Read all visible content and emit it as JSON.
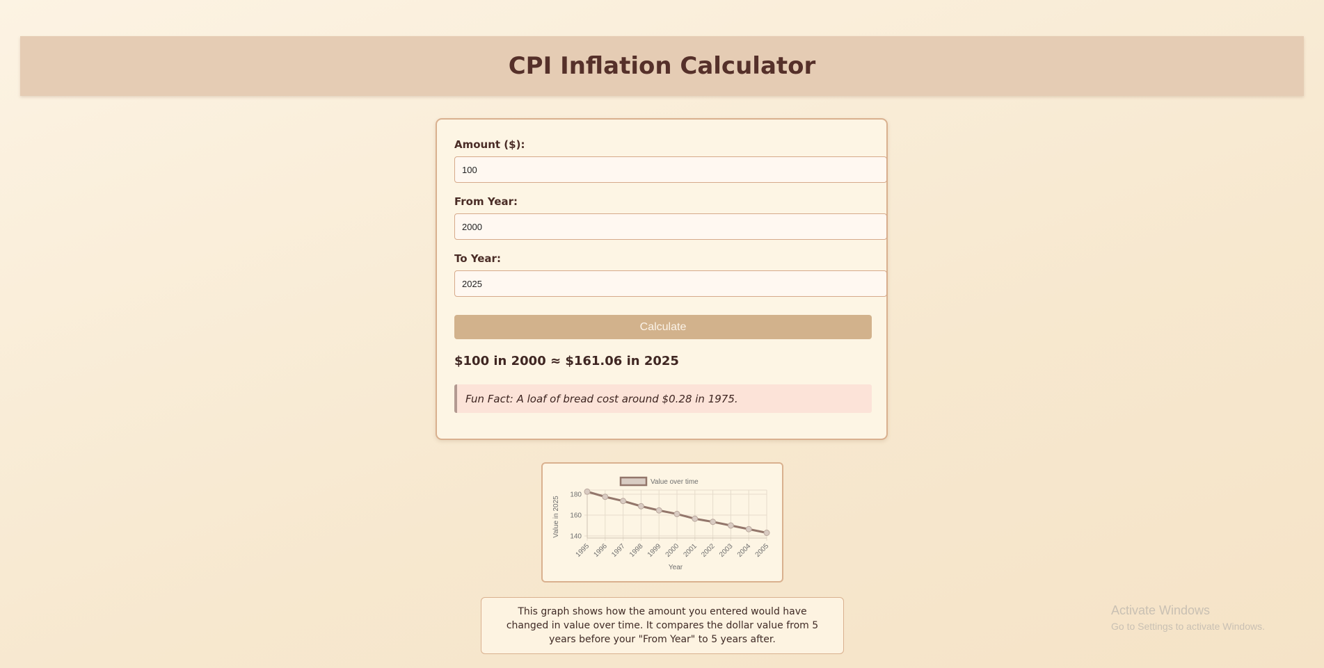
{
  "header": {
    "title": "CPI Inflation Calculator"
  },
  "form": {
    "amount_label": "Amount ($):",
    "amount_value": "100",
    "from_label": "From Year:",
    "from_value": "2000",
    "to_label": "To Year:",
    "to_value": "2025",
    "calculate_label": "Calculate"
  },
  "result": {
    "text": "$100 in 2000 ≈ $161.06 in 2025"
  },
  "fun_fact": {
    "text": "Fun Fact: A loaf of bread cost around $0.28 in 1975."
  },
  "chart_data": {
    "type": "line",
    "legend": "Value over time",
    "xlabel": "Year",
    "ylabel": "Value in 2025",
    "categories": [
      "1995",
      "1996",
      "1997",
      "1998",
      "1999",
      "2000",
      "2001",
      "2002",
      "2003",
      "2004",
      "2005"
    ],
    "series": [
      {
        "name": "Value over time",
        "values": [
          182.5,
          177.5,
          173.5,
          168.5,
          164.5,
          161.06,
          156.5,
          153.5,
          150.0,
          146.5,
          143.0
        ]
      }
    ],
    "yticks": [
      140,
      160,
      180
    ],
    "ylim": [
      138,
      184
    ],
    "grid": true,
    "legend_position": "top",
    "colors": {
      "line": "#93766b",
      "point_fill": "#d9cbc2",
      "legend_box": "#d9ccc3"
    }
  },
  "description": {
    "text": "This graph shows how the amount you entered would have changed in value over time. It compares the dollar value from 5 years before your \"From Year\" to 5 years after."
  },
  "watermark": {
    "title": "Activate Windows",
    "subtitle": "Go to Settings to activate Windows."
  }
}
